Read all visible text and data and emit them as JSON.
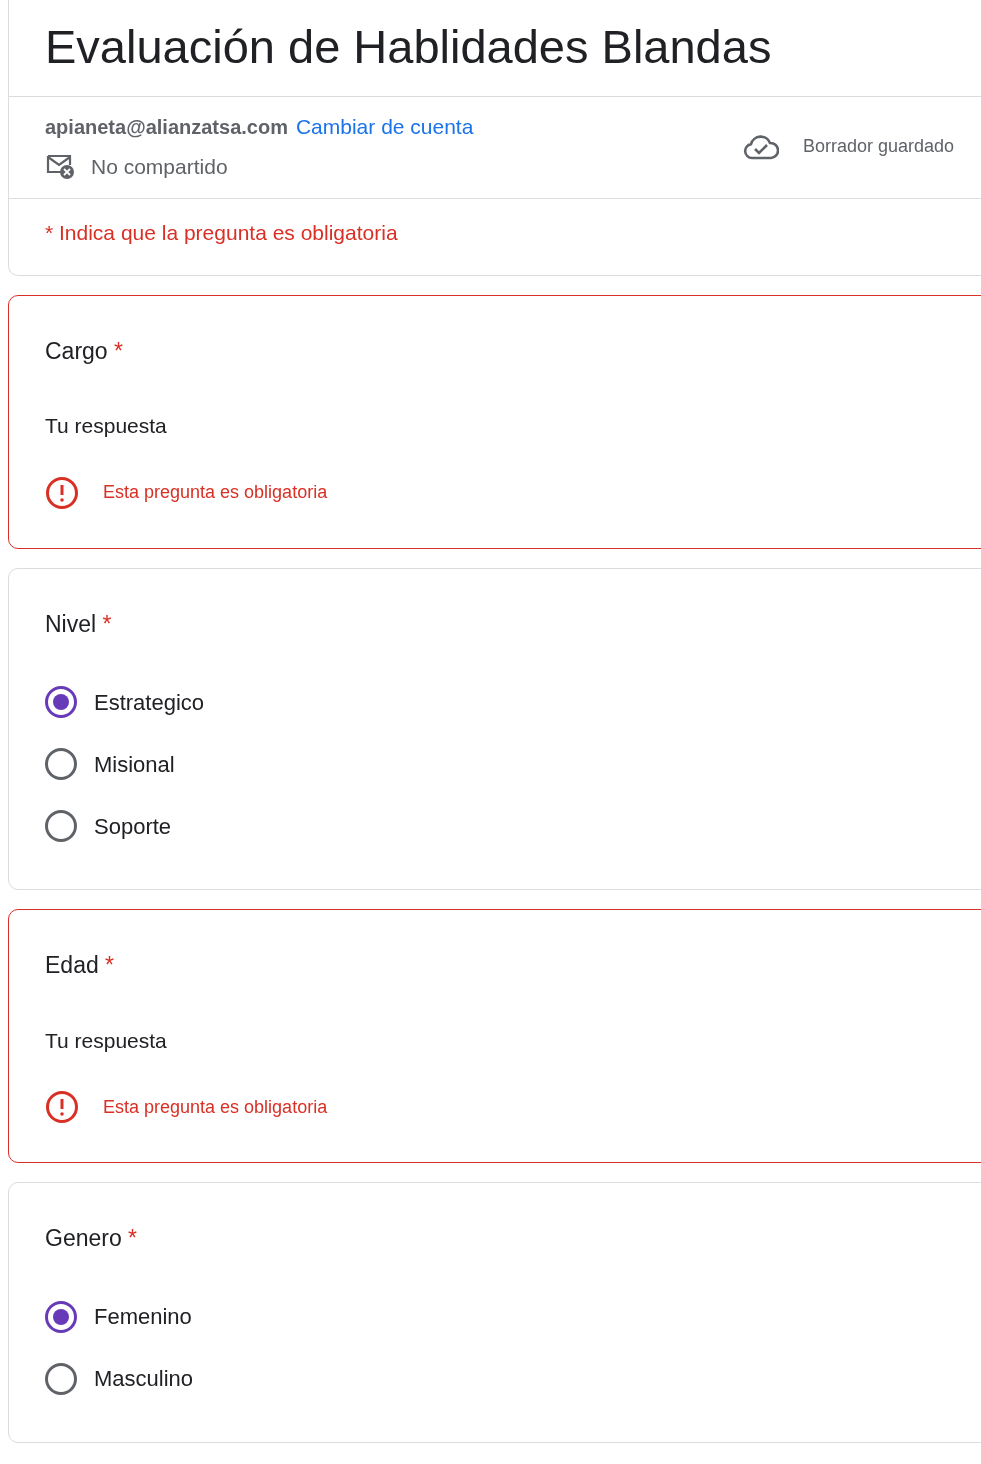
{
  "form": {
    "title": "Evaluación de Hablidades Blandas",
    "account": "apianeta@alianzatsa.com",
    "switch_account": "Cambiar de cuenta",
    "sharing": "No compartido",
    "draft_status": "Borrador guardado",
    "required_note": "* Indica que la pregunta es obligatoria"
  },
  "questions": [
    {
      "kind": "text",
      "title": "Cargo",
      "required_mark": "*",
      "placeholder": "Tu respuesta",
      "error": "Esta pregunta es obligatoria"
    },
    {
      "kind": "radio",
      "title": "Nivel",
      "required_mark": "*",
      "options": [
        {
          "label": "Estrategico",
          "selected": true
        },
        {
          "label": "Misional",
          "selected": false
        },
        {
          "label": "Soporte",
          "selected": false
        }
      ]
    },
    {
      "kind": "text",
      "title": "Edad",
      "required_mark": "*",
      "placeholder": "Tu respuesta",
      "error": "Esta pregunta es obligatoria"
    },
    {
      "kind": "radio",
      "title": "Genero",
      "required_mark": "*",
      "options": [
        {
          "label": "Femenino",
          "selected": true
        },
        {
          "label": "Masculino",
          "selected": false
        }
      ]
    }
  ]
}
